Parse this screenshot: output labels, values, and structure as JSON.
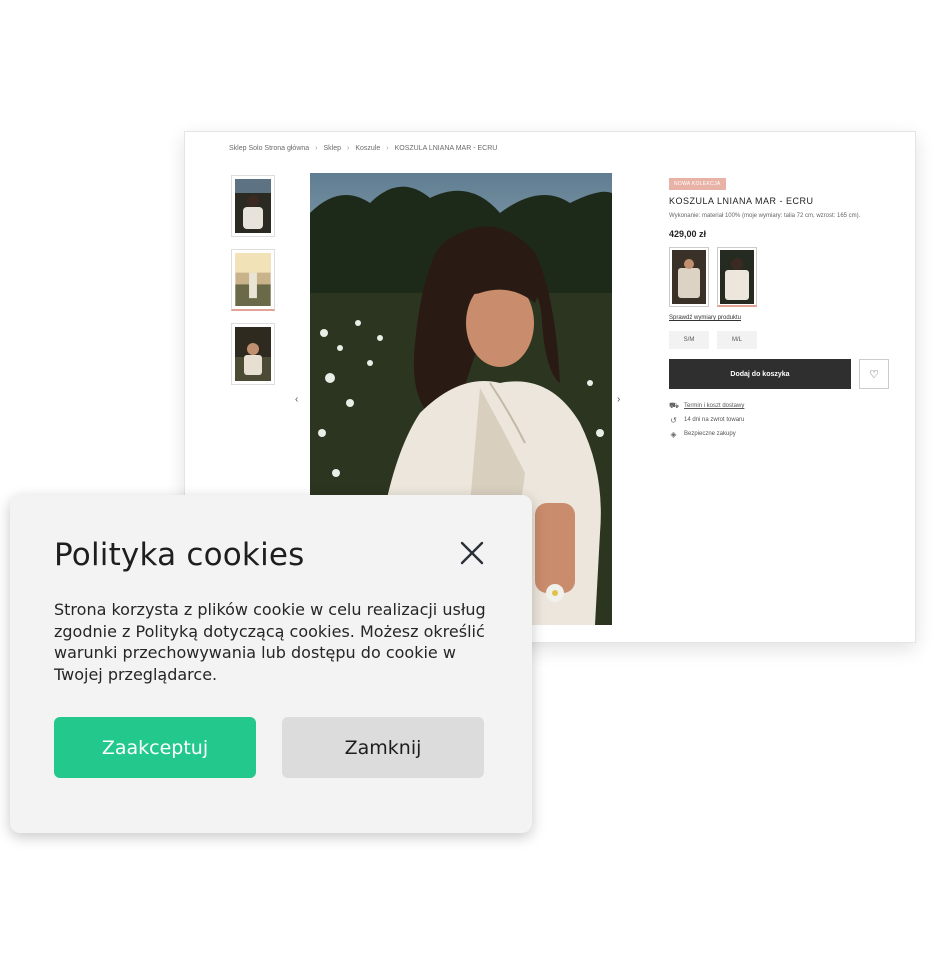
{
  "colors": {
    "accept_button": "#23c98c",
    "close_button": "#dcdcdc",
    "dialog_bg": "#f3f3f3",
    "cart_button": "#2f2f2f",
    "badge": "#e8b3a6"
  },
  "site": {
    "breadcrumb": [
      "Sklep Solo Strona główna",
      "Sklep",
      "Koszule",
      "KOSZULA LNIANA MAR - ECRU"
    ],
    "product": {
      "badge": "NOWA KOLEKCJA",
      "title": "KOSZULA LNIANA MAR - ECRU",
      "description": "Wykonanie: materiał 100% (moje wymiary: talia 72 cm, wzrost: 165 cm).",
      "price": "429,00 zł",
      "size_guide": "Sprawdź wymiary produktu",
      "sizes": [
        "S/M",
        "M/L"
      ],
      "add_to_cart": "Dodaj do koszyka",
      "info": [
        {
          "icon": "truck-icon",
          "text": "Termin i koszt dostawy",
          "link": true
        },
        {
          "icon": "return-icon",
          "text": "14 dni na zwrot towaru",
          "link": false
        },
        {
          "icon": "shield-icon",
          "text": "Bezpieczne zakupy",
          "link": false
        }
      ]
    }
  },
  "cookie": {
    "title": "Polityka cookies",
    "text": "Strona korzysta z plików cookie w celu realizacji usług zgodnie z Polityką dotyczącą cookies. Możesz określić warunki przechowywania lub dostępu do cookie w Twojej przeglądarce.",
    "accept_label": "Zaakceptuj",
    "close_label": "Zamknij"
  }
}
